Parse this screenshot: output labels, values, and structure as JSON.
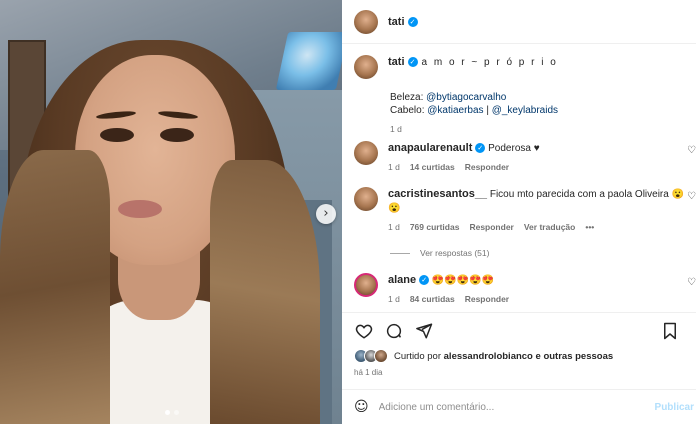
{
  "post_author": {
    "username": "tati",
    "verified": true
  },
  "caption": {
    "username": "tati",
    "title_extra": "a m o r ~ p r ó p r i o",
    "beleza_label": "Beleza:",
    "beleza_handle": "@bytiagocarvalho",
    "cabelo_label": "Cabelo:",
    "cabelo_handle_1": "@katiaerbas",
    "separator": "|",
    "cabelo_handle_2": "@_keylabraids",
    "time": "1 d"
  },
  "comments": [
    {
      "username": "anapaularenault",
      "verified": true,
      "text": "Poderosa ♥",
      "time": "1 d",
      "likes": "14 curtidas",
      "reply": "Responder"
    },
    {
      "username": "cacristinesantos__",
      "verified": false,
      "text": "Ficou mto parecida com a paola Oliveira 😮",
      "second_line": "😮",
      "time": "1 d",
      "likes": "769 curtidas",
      "reply": "Responder",
      "translate": "Ver tradução",
      "more": "•••"
    },
    {
      "username": "alane",
      "verified": true,
      "text": "😍😍😍😍😍",
      "time": "1 d",
      "likes": "84 curtidas",
      "reply": "Responder"
    }
  ],
  "view_replies": "Ver respostas (51)",
  "likes_summary": {
    "prefix": "Curtido por",
    "user": "alessandrolobianco",
    "suffix": "e outras pessoas"
  },
  "posted_at": "há 1 dia",
  "comment_box": {
    "placeholder": "Adicione um comentário...",
    "publish": "Publicar"
  },
  "icons": {
    "like": "heart-icon",
    "comment": "comment-icon",
    "share": "send-icon",
    "save": "bookmark-icon",
    "emoji": "emoji-icon",
    "next": "chevron-right-icon",
    "verified": "verified-badge-icon"
  },
  "colors": {
    "verified": "#0095f6",
    "link": "#00376b",
    "muted": "#737373",
    "publish_disabled": "#b2dffc"
  }
}
